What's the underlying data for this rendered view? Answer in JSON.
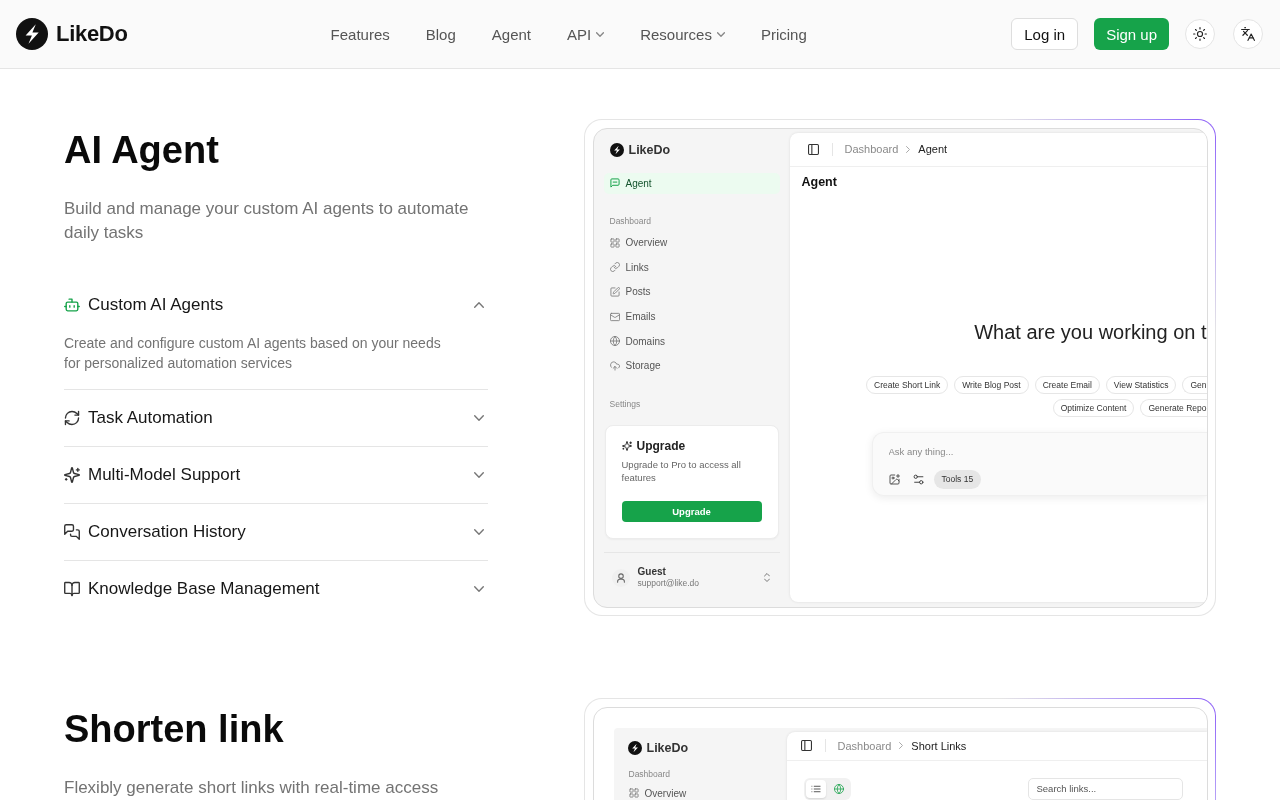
{
  "header": {
    "brand": "LikeDo",
    "nav": [
      {
        "label": "Features",
        "has_menu": false
      },
      {
        "label": "Blog",
        "has_menu": false
      },
      {
        "label": "Agent",
        "has_menu": false
      },
      {
        "label": "API",
        "has_menu": true
      },
      {
        "label": "Resources",
        "has_menu": true
      },
      {
        "label": "Pricing",
        "has_menu": false
      }
    ],
    "login": "Log in",
    "signup": "Sign up"
  },
  "agent_section": {
    "title": "AI Agent",
    "subtitle": "Build and manage your custom AI agents to automate daily tasks",
    "features": [
      {
        "title": "Custom AI Agents",
        "expanded": true,
        "description": "Create and configure custom AI agents based on your needs for personalized automation services"
      },
      {
        "title": "Task Automation",
        "expanded": false
      },
      {
        "title": "Multi-Model Support",
        "expanded": false
      },
      {
        "title": "Conversation History",
        "expanded": false
      },
      {
        "title": "Knowledge Base Management",
        "expanded": false
      }
    ],
    "preview": {
      "sidebar": {
        "brand": "LikeDo",
        "pinned": [
          {
            "label": "Agent",
            "selected": true
          }
        ],
        "groups": [
          {
            "label": "Dashboard",
            "items": [
              {
                "label": "Overview",
                "selected": false
              },
              {
                "label": "Links",
                "selected": false
              },
              {
                "label": "Posts",
                "selected": false
              },
              {
                "label": "Emails",
                "selected": false
              },
              {
                "label": "Domains",
                "selected": false
              },
              {
                "label": "Storage",
                "selected": false
              }
            ]
          },
          {
            "label": "Settings"
          }
        ],
        "upgrade_card": {
          "title": "Upgrade",
          "text": "Upgrade to Pro to access all features",
          "button": "Upgrade"
        },
        "user": {
          "name": "Guest",
          "email": "support@like.do"
        }
      },
      "breadcrumb": [
        "Dashboard",
        "Agent"
      ],
      "page_title": "Agent",
      "headline": "What are you working on t",
      "suggestion_rows": [
        [
          "Create Short Link",
          "Write Blog Post",
          "Create Email",
          "View Statistics",
          "Gen"
        ],
        [
          "Optimize Content",
          "Generate Repo"
        ]
      ],
      "prompt": {
        "placeholder": "Ask any thing...",
        "tools_chip": "Tools 15"
      }
    }
  },
  "shorten_link_section": {
    "title": "Shorten link",
    "subtitle": "Flexibly generate short links with real-time access",
    "preview": {
      "sidebar": {
        "brand": "LikeDo",
        "groups": [
          {
            "label": "Dashboard",
            "items": [
              {
                "label": "Overview",
                "selected": false
              }
            ]
          }
        ]
      },
      "breadcrumb": [
        "Dashboard",
        "Short Links"
      ],
      "view_toggle": [
        {
          "selected": true
        },
        {
          "selected": false
        }
      ],
      "search": {
        "placeholder": "Search links..."
      }
    }
  }
}
